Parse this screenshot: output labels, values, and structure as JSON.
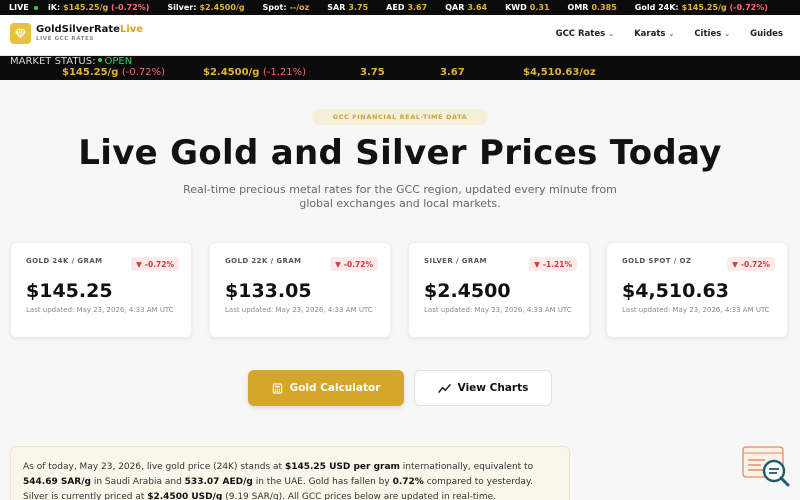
{
  "ticker": {
    "live_label": "LIVE",
    "items": [
      {
        "k": "iK:",
        "v": "$145.25/g",
        "chg": "(-0.72%)"
      },
      {
        "k": "Silver:",
        "v": "$2.4500/g",
        "chg": ""
      },
      {
        "k": "Spot:",
        "v": "--/oz",
        "chg": ""
      },
      {
        "k": "SAR",
        "v": "3.75",
        "chg": ""
      },
      {
        "k": "AED",
        "v": "3.67",
        "chg": ""
      },
      {
        "k": "QAR",
        "v": "3.64",
        "chg": ""
      },
      {
        "k": "KWD",
        "v": "0.31",
        "chg": ""
      },
      {
        "k": "OMR",
        "v": "0.385",
        "chg": ""
      },
      {
        "k": "Gold 24K:",
        "v": "$145.25/g",
        "chg": "(-0.72%)"
      }
    ]
  },
  "header": {
    "brand_main": "GoldSilverRate",
    "brand_accent": "Live",
    "brand_sub": "LIVE GCC RATES",
    "nav": [
      {
        "label": "GCC Rates",
        "dropdown": true
      },
      {
        "label": "Karats",
        "dropdown": true
      },
      {
        "label": "Cities",
        "dropdown": true
      },
      {
        "label": "Guides",
        "dropdown": false
      }
    ],
    "accent_color": "#d4a72a"
  },
  "market": {
    "status_label": "MARKET STATUS:",
    "status_value": "OPEN",
    "gold": "$145.25/g",
    "gold_chg": "(-0.72%)",
    "silver": "$2.4500/g",
    "silver_chg": "(-1.21%)",
    "sar": "3.75",
    "aed": "3.67",
    "spot": "$4,510.63/oz"
  },
  "hero": {
    "badge": "GCC FINANCIAL REAL-TIME DATA",
    "title": "Live Gold and Silver Prices Today",
    "lead": "Real-time precious metal rates for the GCC region, updated every minute from global exchanges and local markets."
  },
  "cards": [
    {
      "title": "GOLD 24K / GRAM",
      "change": "-0.72%",
      "price": "$145.25",
      "updated": "Last updated: May 23, 2026, 4:33 AM UTC"
    },
    {
      "title": "GOLD 22K / GRAM",
      "change": "-0.72%",
      "price": "$133.05",
      "updated": "Last updated: May 23, 2026, 4:33 AM UTC"
    },
    {
      "title": "SILVER / GRAM",
      "change": "-1.21%",
      "price": "$2.4500",
      "updated": "Last updated: May 23, 2026, 4:33 AM UTC"
    },
    {
      "title": "GOLD SPOT / OZ",
      "change": "-0.72%",
      "price": "$4,510.63",
      "updated": "Last updated: May 23, 2026, 4:33 AM UTC"
    }
  ],
  "buttons": {
    "calculator": "Gold Calculator",
    "charts": "View Charts"
  },
  "summary": {
    "t1": "As of today, May 23, 2026, live gold price (24K) stands at ",
    "b1": "$145.25 USD per gram",
    "t2": " internationally, equivalent to ",
    "b2": "544.69 SAR/g",
    "t3": " in Saudi Arabia and ",
    "b3": "533.07 AED/g",
    "t4": " in the UAE. Gold has fallen by ",
    "b4": "0.72%",
    "t5": " compared to yesterday. Silver is currently priced at ",
    "b5": "$2.4500 USD/g",
    "t6": " (9.19 SAR/g). All GCC prices below are updated in real-time."
  }
}
